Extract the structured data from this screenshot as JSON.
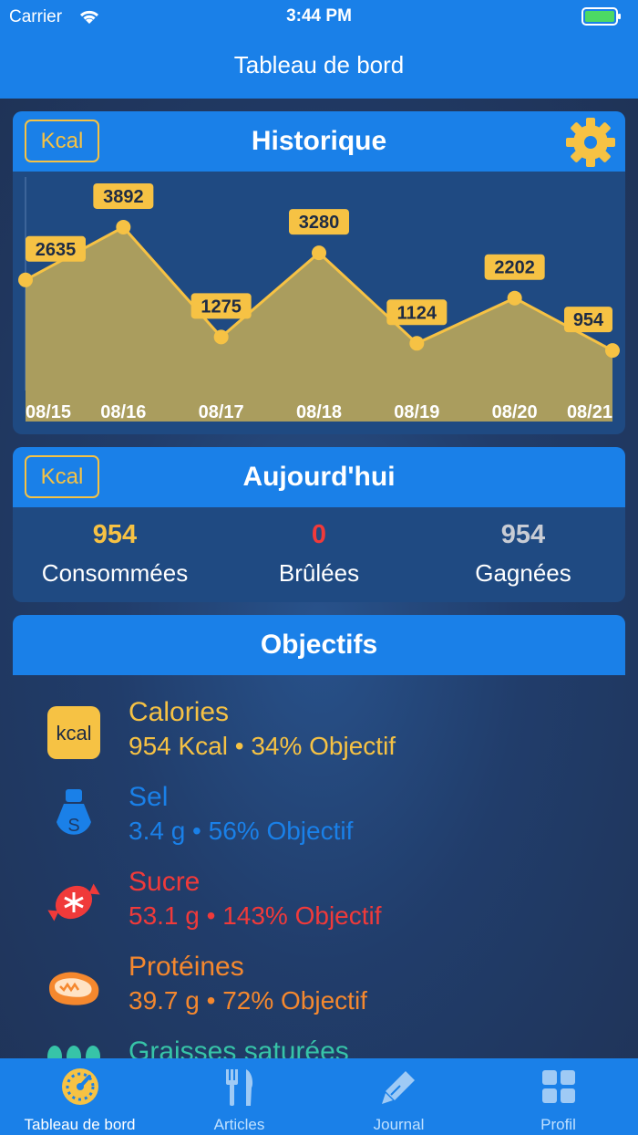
{
  "status_bar": {
    "carrier": "Carrier",
    "time": "3:44 PM"
  },
  "nav": {
    "title": "Tableau de bord"
  },
  "history": {
    "title": "Historique",
    "unit_button": "Kcal",
    "chart_data": {
      "type": "area",
      "x": [
        "08/15",
        "08/16",
        "08/17",
        "08/18",
        "08/19",
        "08/20",
        "08/21"
      ],
      "values": [
        2635,
        3892,
        1275,
        3280,
        1124,
        2202,
        954
      ],
      "ylim": [
        0,
        5000
      ],
      "grid": false,
      "fill_color": "#b9a65a",
      "line_color": "#f6c244"
    }
  },
  "today": {
    "title": "Aujourd'hui",
    "unit_button": "Kcal",
    "stats": [
      {
        "value": "954",
        "label": "Consommées",
        "color": "#f6c244"
      },
      {
        "value": "0",
        "label": "Brûlées",
        "color": "#f03a3a"
      },
      {
        "value": "954",
        "label": "Gagnées",
        "color": "#c8ccd4"
      }
    ]
  },
  "goals": {
    "title": "Objectifs",
    "items": [
      {
        "icon": "kcal-icon",
        "icon_text": "kcal",
        "name": "Calories",
        "detail": "954 Kcal • 34% Objectif",
        "color": "#f6c244"
      },
      {
        "icon": "salt-shaker-icon",
        "icon_text": "S",
        "name": "Sel",
        "detail": "3.4 g • 56% Objectif",
        "color": "#1a80e8"
      },
      {
        "icon": "candy-icon",
        "icon_text": "",
        "name": "Sucre",
        "detail": "53.1 g • 143% Objectif",
        "color": "#f03a3a"
      },
      {
        "icon": "steak-icon",
        "icon_text": "",
        "name": "Protéines",
        "detail": "39.7 g • 72% Objectif",
        "color": "#f5882e"
      },
      {
        "icon": "fat-drops-icon",
        "icon_text": "",
        "name": "Graisses saturées",
        "detail": "",
        "color": "#37c4a8"
      }
    ]
  },
  "tabbar": {
    "tabs": [
      {
        "label": "Tableau de bord",
        "icon": "speedometer-icon",
        "active": true
      },
      {
        "label": "Articles",
        "icon": "fork-knife-icon",
        "active": false
      },
      {
        "label": "Journal",
        "icon": "pen-icon",
        "active": false
      },
      {
        "label": "Profil",
        "icon": "grid-icon",
        "active": false
      }
    ]
  }
}
